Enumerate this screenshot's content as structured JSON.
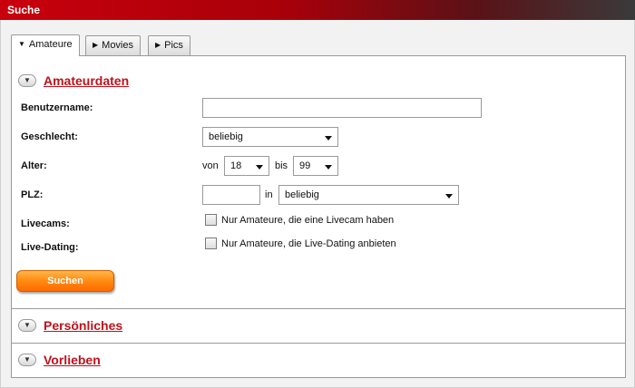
{
  "window": {
    "title": "Suche"
  },
  "tabs": [
    {
      "label": "Amateure",
      "active": true
    },
    {
      "label": "Movies",
      "active": false
    },
    {
      "label": "Pics",
      "active": false
    }
  ],
  "sections": {
    "amateurdaten": "Amateurdaten",
    "persoenliches": "Persönliches",
    "vorlieben": "Vorlieben"
  },
  "form": {
    "username_label": "Benutzername:",
    "username_value": "",
    "gender_label": "Geschlecht:",
    "gender_value": "beliebig",
    "age_label": "Alter:",
    "age_from_prefix": "von",
    "age_from_value": "18",
    "age_to_prefix": "bis",
    "age_to_value": "99",
    "plz_label": "PLZ:",
    "plz_value": "",
    "plz_in": "in",
    "plz_region_value": "beliebig",
    "livecams_label": "Livecams:",
    "livecams_checkbox": "Nur Amateure, die eine Livecam haben",
    "livedating_label": "Live-Dating:",
    "livedating_checkbox": "Nur Amateure, die Live-Dating anbieten",
    "submit_label": "Suchen"
  },
  "colors": {
    "accent": "#c0101a",
    "button": "#ff8a10"
  }
}
